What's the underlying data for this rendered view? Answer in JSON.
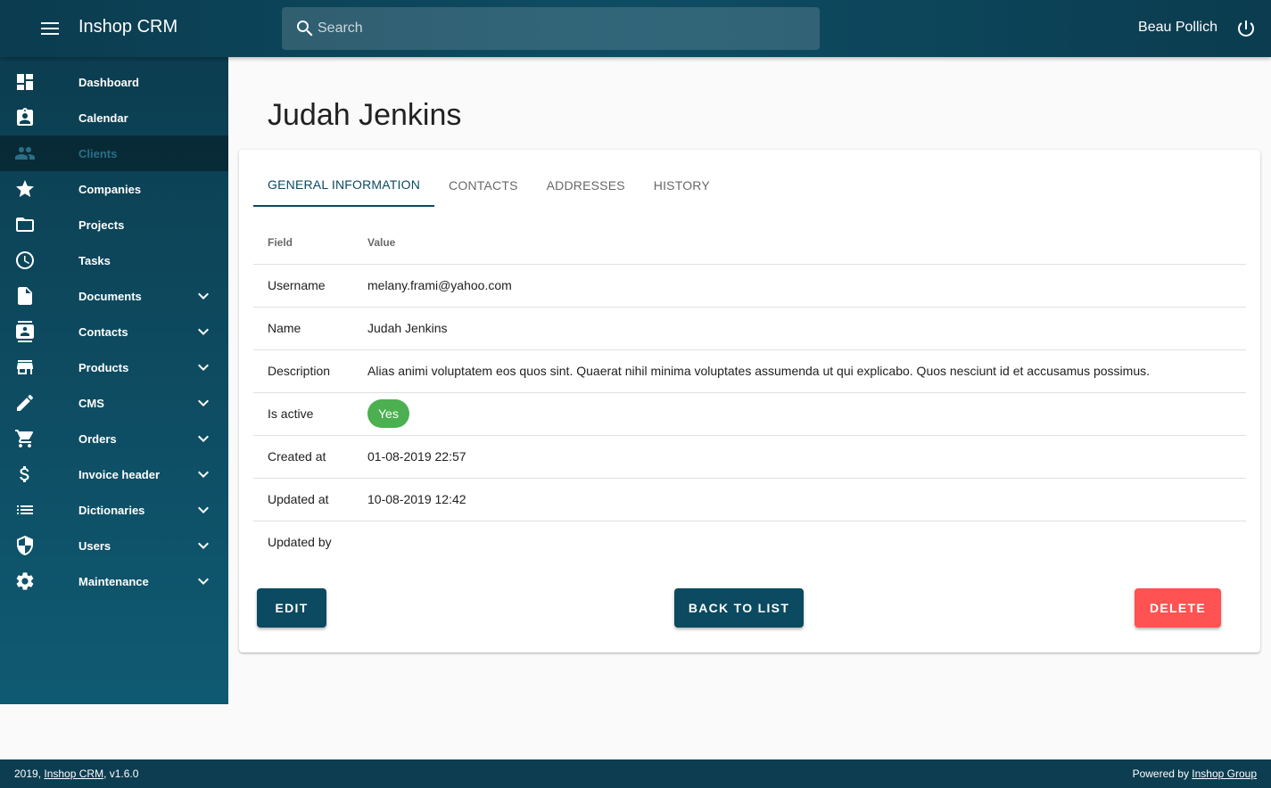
{
  "header": {
    "app_title": "Inshop CRM",
    "search_placeholder": "Search",
    "user_name": "Beau Pollich"
  },
  "sidebar": {
    "items": [
      {
        "label": "Dashboard",
        "icon": "dashboard-icon",
        "expandable": false,
        "active": false
      },
      {
        "label": "Calendar",
        "icon": "calendar-icon",
        "expandable": false,
        "active": false
      },
      {
        "label": "Clients",
        "icon": "people-icon",
        "expandable": false,
        "active": true
      },
      {
        "label": "Companies",
        "icon": "star-icon",
        "expandable": false,
        "active": false
      },
      {
        "label": "Projects",
        "icon": "folder-icon",
        "expandable": false,
        "active": false
      },
      {
        "label": "Tasks",
        "icon": "clock-icon",
        "expandable": false,
        "active": false
      },
      {
        "label": "Documents",
        "icon": "document-icon",
        "expandable": true,
        "active": false
      },
      {
        "label": "Contacts",
        "icon": "contact-icon",
        "expandable": true,
        "active": false
      },
      {
        "label": "Products",
        "icon": "store-icon",
        "expandable": true,
        "active": false
      },
      {
        "label": "CMS",
        "icon": "pencil-icon",
        "expandable": true,
        "active": false
      },
      {
        "label": "Orders",
        "icon": "cart-icon",
        "expandable": true,
        "active": false
      },
      {
        "label": "Invoice header",
        "icon": "dollar-icon",
        "expandable": true,
        "active": false
      },
      {
        "label": "Dictionaries",
        "icon": "list-icon",
        "expandable": true,
        "active": false
      },
      {
        "label": "Users",
        "icon": "shield-icon",
        "expandable": true,
        "active": false
      },
      {
        "label": "Maintenance",
        "icon": "gear-icon",
        "expandable": true,
        "active": false
      }
    ]
  },
  "main": {
    "page_title": "Judah Jenkins",
    "tabs": [
      {
        "label": "GENERAL INFORMATION",
        "active": true
      },
      {
        "label": "CONTACTS",
        "active": false
      },
      {
        "label": "ADDRESSES",
        "active": false
      },
      {
        "label": "HISTORY",
        "active": false
      }
    ],
    "table": {
      "headers": [
        "Field",
        "Value"
      ],
      "rows": [
        {
          "field": "Username",
          "value": "melany.frami@yahoo.com"
        },
        {
          "field": "Name",
          "value": "Judah Jenkins"
        },
        {
          "field": "Description",
          "value": "Alias animi voluptatem eos quos sint. Quaerat nihil minima voluptates assumenda ut qui explicabo. Quos nesciunt id et accusamus possimus."
        },
        {
          "field": "Is active",
          "value": "Yes",
          "chip": true
        },
        {
          "field": "Created at",
          "value": "01-08-2019 22:57"
        },
        {
          "field": "Updated at",
          "value": "10-08-2019 12:42"
        },
        {
          "field": "Updated by",
          "value": ""
        }
      ]
    },
    "buttons": {
      "edit": "EDIT",
      "back": "BACK TO LIST",
      "delete": "DELETE"
    }
  },
  "footer": {
    "left_prefix": "2019, ",
    "left_link": "Inshop CRM",
    "left_suffix": ", v1.6.0",
    "right_prefix": "Powered by ",
    "right_link": "Inshop Group"
  },
  "colors": {
    "primary": "#0b4a60",
    "danger": "#ff5252",
    "success": "#4caf50"
  }
}
